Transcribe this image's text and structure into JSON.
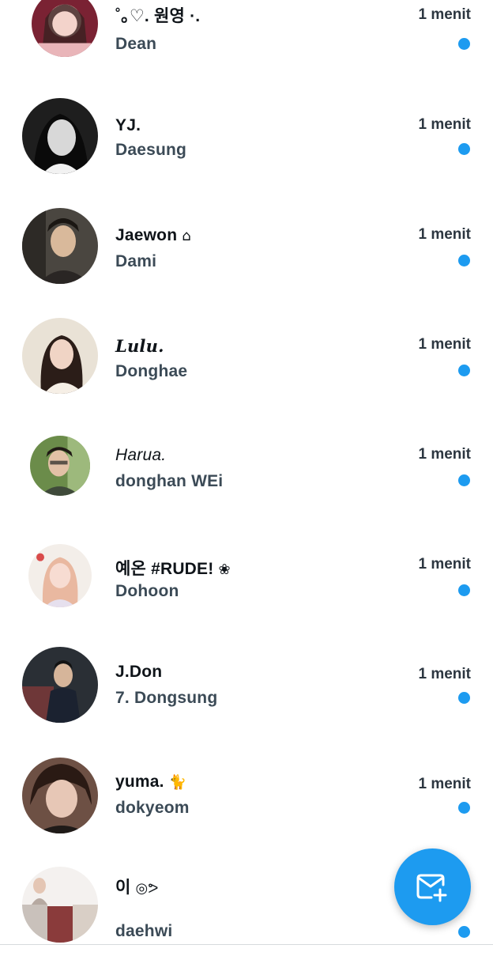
{
  "theme": {
    "accent": "#1d9bf0",
    "text_primary": "#0f1419",
    "text_secondary": "#3b4a56"
  },
  "conversations": [
    {
      "name": "˚｡♡. 원영 ·.",
      "preview": "Dean",
      "time": "1 menit",
      "unread": true,
      "avatar_icon": "avatar-photo"
    },
    {
      "name": "YJ.",
      "preview": "Daesung",
      "time": "1 menit",
      "unread": true,
      "avatar_icon": "avatar-photo"
    },
    {
      "name": "Jaewon",
      "name_emoji": "⌂",
      "preview": "Dami",
      "time": "1 menit",
      "unread": true,
      "avatar_icon": "avatar-photo"
    },
    {
      "name": "Lulu.",
      "preview": "Donghae",
      "time": "1 menit",
      "unread": true,
      "avatar_icon": "avatar-photo"
    },
    {
      "name": "Harua.",
      "preview": "donghan WEi",
      "time": "1 menit",
      "unread": true,
      "avatar_icon": "avatar-photo"
    },
    {
      "name": "예온 #RUDE!",
      "name_emoji": "❀",
      "preview": "Dohoon",
      "time": "1 menit",
      "unread": true,
      "avatar_icon": "avatar-photo"
    },
    {
      "name": "J.Don",
      "preview": "7. Dongsung",
      "time": "1 menit",
      "unread": true,
      "avatar_icon": "avatar-photo"
    },
    {
      "name": "yuma.",
      "name_emoji": "🐈",
      "preview": "dokyeom",
      "time": "1 menit",
      "unread": true,
      "avatar_icon": "avatar-photo"
    },
    {
      "name": "이",
      "name_emoji": "◎ᕗ",
      "preview": "daehwi",
      "time": "",
      "unread": true,
      "avatar_icon": "avatar-photo"
    }
  ],
  "fab": {
    "icon": "new-message-icon"
  }
}
